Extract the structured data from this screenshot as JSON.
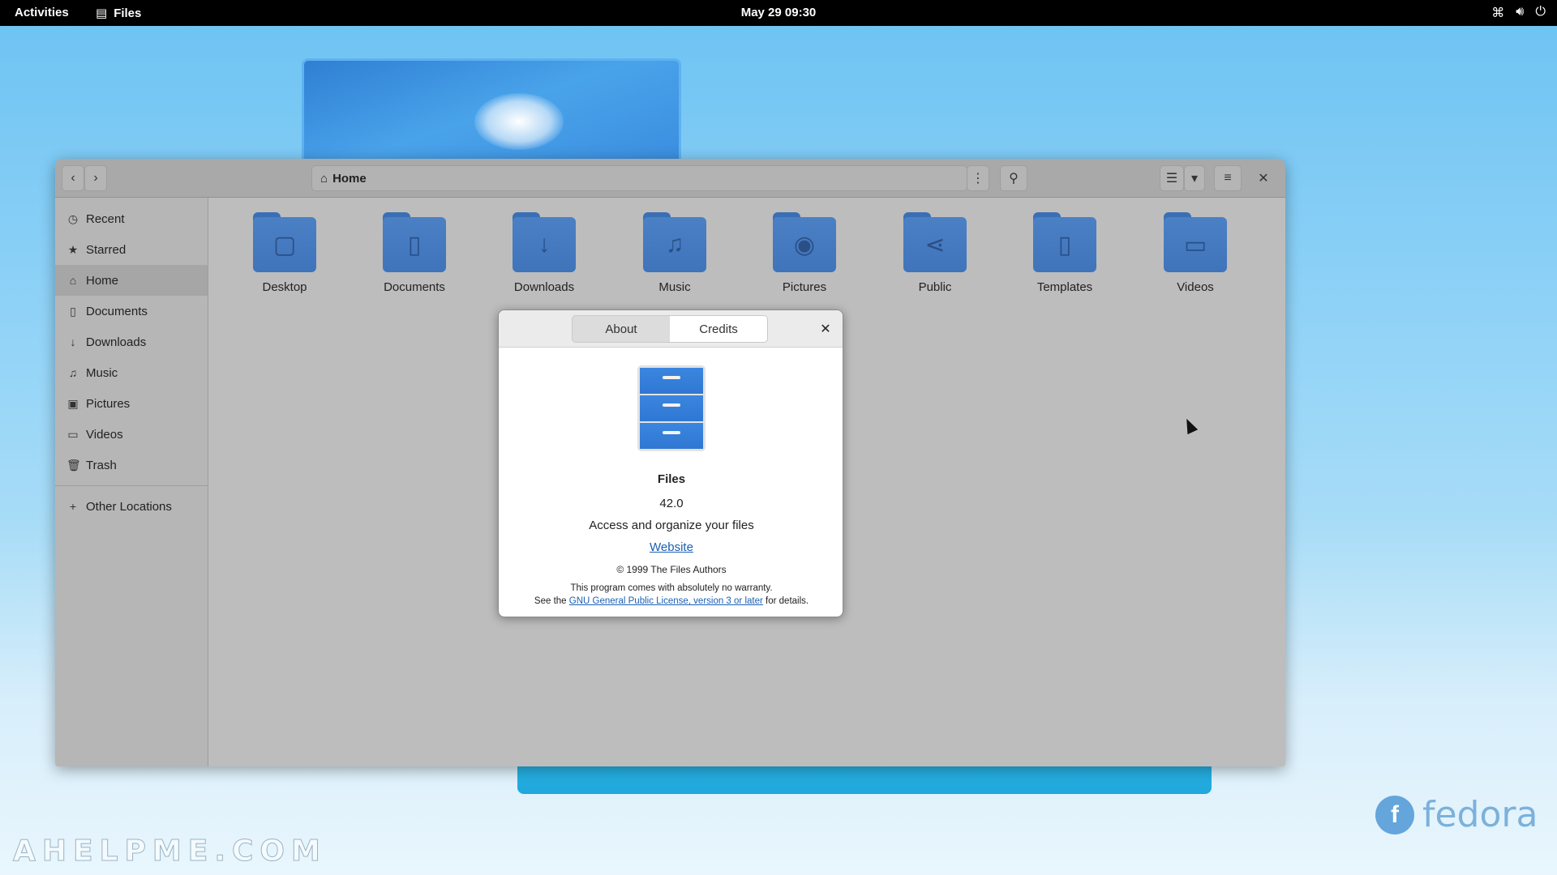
{
  "topbar": {
    "activities": "Activities",
    "app_name": "Files",
    "clock": "May 29  09:30",
    "tray": {
      "network": "network-icon",
      "volume": "volume-icon",
      "power": "power-icon"
    }
  },
  "window": {
    "location": "Home",
    "sidebar": [
      {
        "label": "Recent",
        "icon": "clock-icon"
      },
      {
        "label": "Starred",
        "icon": "star-icon"
      },
      {
        "label": "Home",
        "icon": "home-icon",
        "active": true
      },
      {
        "label": "Documents",
        "icon": "document-icon"
      },
      {
        "label": "Downloads",
        "icon": "download-icon"
      },
      {
        "label": "Music",
        "icon": "music-icon"
      },
      {
        "label": "Pictures",
        "icon": "camera-icon"
      },
      {
        "label": "Videos",
        "icon": "video-icon"
      },
      {
        "label": "Trash",
        "icon": "trash-icon"
      },
      {
        "label": "Other Locations",
        "icon": "plus-icon"
      }
    ],
    "folders": [
      {
        "label": "Desktop",
        "icon": "desktop-icon"
      },
      {
        "label": "Documents",
        "icon": "document-icon"
      },
      {
        "label": "Downloads",
        "icon": "download-icon"
      },
      {
        "label": "Music",
        "icon": "music-icon"
      },
      {
        "label": "Pictures",
        "icon": "camera-icon"
      },
      {
        "label": "Public",
        "icon": "share-icon"
      },
      {
        "label": "Templates",
        "icon": "template-icon"
      },
      {
        "label": "Videos",
        "icon": "video-icon"
      }
    ]
  },
  "about_dialog": {
    "tabs": [
      "About",
      "Credits"
    ],
    "selected_tab": "Credits",
    "app_name": "Files",
    "version": "42.0",
    "description": "Access and organize your files",
    "website": "Website",
    "copyright": "© 1999 The Files Authors",
    "warranty": "This program comes with absolutely no warranty.",
    "license_prefix": "See the",
    "license_link": "GNU General Public License, version 3 or later",
    "license_suffix": "for details."
  },
  "desktop": {
    "watermark": "AHELPME.COM",
    "logo_text": "fedora"
  },
  "colors": {
    "topbar": "#000000",
    "folder": "#4b80c5",
    "accent_link": "#1a5fb4"
  }
}
